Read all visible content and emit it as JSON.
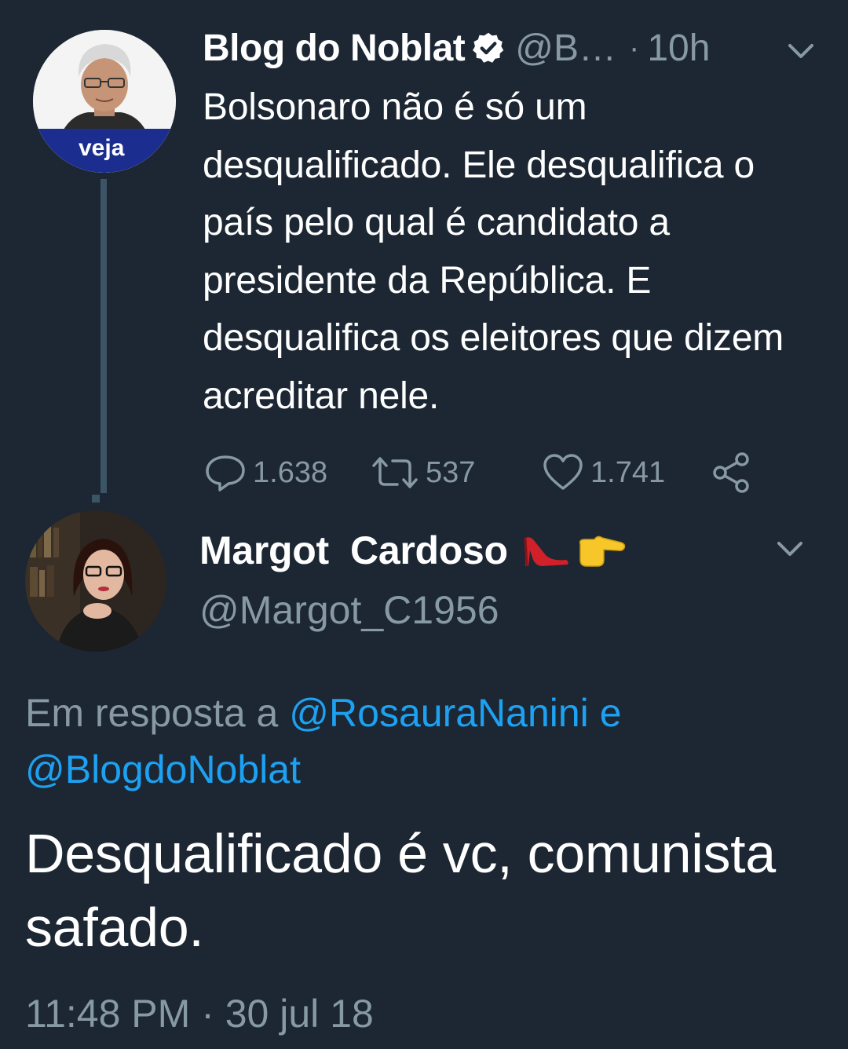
{
  "tweet": {
    "author_name": "Blog do Noblat",
    "author_handle": "@B…",
    "separator": "·",
    "time": "10h",
    "avatar_badge": "veja",
    "text": "Bolsonaro não é só um desqualificado. Ele desqualifica o país pelo qual é candidato a presidente da República. E desqualifica os eleitores que dizem acreditar nele.",
    "stats": {
      "replies": "1.638",
      "retweets": "537",
      "likes": "1.741"
    },
    "icons": [
      "reply-icon",
      "retweet-icon",
      "like-icon",
      "share-icon",
      "verified-badge-icon",
      "chevron-down-icon"
    ]
  },
  "reply": {
    "author_name": "Margot  Cardoso",
    "author_emojis": [
      "high-heel-icon",
      "pointing-right-icon"
    ],
    "author_handle": "@Margot_C1956",
    "reply_prefix": "Em resposta a",
    "reply_mention_1": "@RosauraNanini",
    "reply_conjunction": "e",
    "reply_mention_2": "@BlogdoNoblat",
    "text": "Desqualificado é vc, comunista safado.",
    "timestamp": "11:48 PM · 30 jul 18"
  },
  "colors": {
    "background": "#1c2733",
    "primary_text": "#ffffff",
    "secondary_text": "#8899a6",
    "link": "#1da1f2",
    "thread_line": "#3d5466"
  }
}
